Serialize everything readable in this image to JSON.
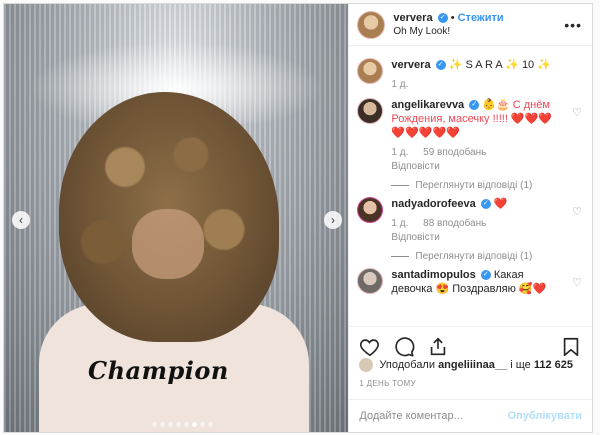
{
  "post": {
    "username": "ververa",
    "follow_label": "Стежити",
    "location": "Oh My Look!",
    "more": "•••"
  },
  "photo": {
    "brand_text": "Champion",
    "slide_count": 8,
    "active_slide": 6
  },
  "comments": [
    {
      "username": "ververa",
      "text": "✨ S A R A ✨ 10 ✨",
      "time": "1 д."
    },
    {
      "username": "angelikarevva",
      "text": "👶🎂 С днём Рождения, масечку !!!!! ❤️❤️❤️❤️❤️❤️❤️❤️",
      "time": "1 д.",
      "likes": "59 вподобань",
      "reply": "Відповісти",
      "view_replies": "Переглянути відповіді (1)"
    },
    {
      "username": "nadyadorofeeva",
      "text": "❤️",
      "time": "1 д.",
      "likes": "88 вподобань",
      "reply": "Відповісти",
      "view_replies": "Переглянути відповіді (1)"
    },
    {
      "username": "santadimopulos",
      "text": "Какая девочка 😍 Поздравляю 🥰❤️"
    }
  ],
  "likes": {
    "liked_by": "Уподобали",
    "user": "angeliiinaa__",
    "and": "і ще",
    "count": "112 625"
  },
  "time_ago": "1 ДЕНЬ ТОМУ",
  "add_comment": {
    "placeholder": "Додайте коментар...",
    "post_label": "Опублікувати"
  },
  "colors": {
    "accent": "#3897f0",
    "heart_red": "#ed4956",
    "muted": "#8e8e8e"
  }
}
